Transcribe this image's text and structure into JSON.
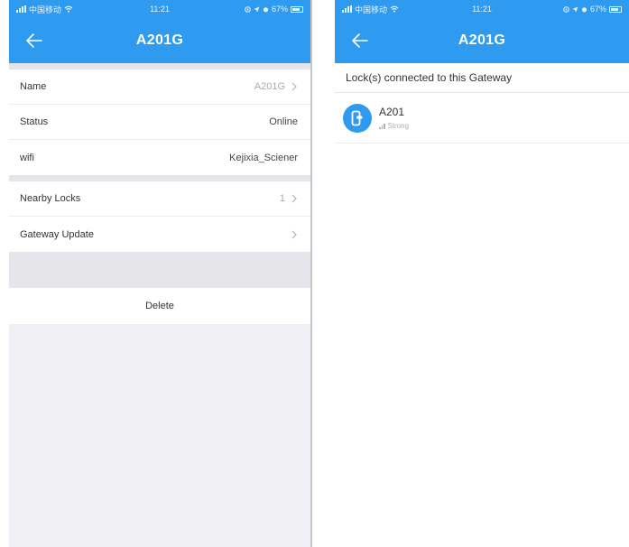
{
  "statusbar": {
    "carrier": "中国移动",
    "time": "11:21",
    "battery": "67%"
  },
  "left_screen": {
    "title": "A201G",
    "rows": [
      {
        "label": "Name",
        "value": "A201G"
      },
      {
        "label": "Status",
        "value": "Online"
      },
      {
        "label": "wifi",
        "value": "Kejixia_Sciener"
      }
    ],
    "rows2": [
      {
        "label": "Nearby Locks",
        "value": "1"
      },
      {
        "label": "Gateway Update",
        "value": ""
      }
    ],
    "delete_label": "Delete"
  },
  "right_screen": {
    "title": "A201G",
    "section_header": "Lock(s) connected to this Gateway",
    "locks": [
      {
        "name": "A201",
        "signal": "Strong"
      }
    ]
  },
  "colors": {
    "accent": "#2e9bf0",
    "background": "#efeff4"
  },
  "icons": [
    "back-arrow-icon",
    "chevron-right-icon",
    "lock-icon",
    "signal-icon",
    "wifi-icon",
    "battery-icon"
  ]
}
